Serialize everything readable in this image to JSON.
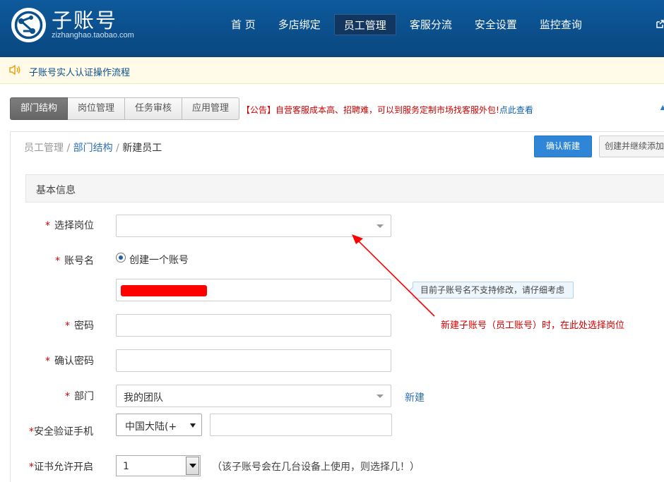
{
  "header": {
    "logo_title": "子账号",
    "logo_sub": "zizhanghao.taobao.com",
    "nav": [
      {
        "label": "首 页",
        "active": false
      },
      {
        "label": "多店绑定",
        "active": false
      },
      {
        "label": "员工管理",
        "active": true
      },
      {
        "label": "客服分流",
        "active": false
      },
      {
        "label": "安全设置",
        "active": false
      },
      {
        "label": "监控查询",
        "active": false
      }
    ]
  },
  "notice": {
    "text": "子账号实人认证操作流程"
  },
  "tabs": [
    {
      "label": "部门结构",
      "active": true
    },
    {
      "label": "岗位管理",
      "active": false
    },
    {
      "label": "任务审核",
      "active": false
    },
    {
      "label": "应用管理",
      "active": false
    }
  ],
  "announcement": {
    "prefix": "【公告】自营客服成本高、招聘难，可以到服务定制市场找客服外包!",
    "link": "点此查看"
  },
  "breadcrumb": {
    "root": "员工管理",
    "sep": "/",
    "mid": "部门结构",
    "current": "新建员工"
  },
  "actions": {
    "confirm": "确认新建",
    "continue": "创建并继续添加"
  },
  "section": {
    "title": "基本信息"
  },
  "form": {
    "star": "*",
    "position_label": "选择岗位",
    "position_value": "",
    "account_label": "账号名",
    "account_radio": "创建一个账号",
    "account_tip": "目前子账号名不支持修改，请仔细考虑",
    "password_label": "密码",
    "confirm_password_label": "确认密码",
    "department_label": "部门",
    "department_value": "我的团队",
    "department_new": "新建",
    "phone_label": "安全验证手机",
    "phone_country": "中国大陆(+",
    "cert_label": "证书允许开启",
    "cert_value": "1",
    "cert_hint": "（该子账号会在几台设备上使用，则选择几！）"
  },
  "annotation": {
    "text": "新建子账号（员工账号）时，在此处选择岗位"
  },
  "colors": {
    "header_blue": "#0b4f8c",
    "confirm_blue": "#2f86d6",
    "required_red": "#d40000",
    "annotation_red": "#ff0000",
    "link_blue": "#2d6fb5"
  }
}
